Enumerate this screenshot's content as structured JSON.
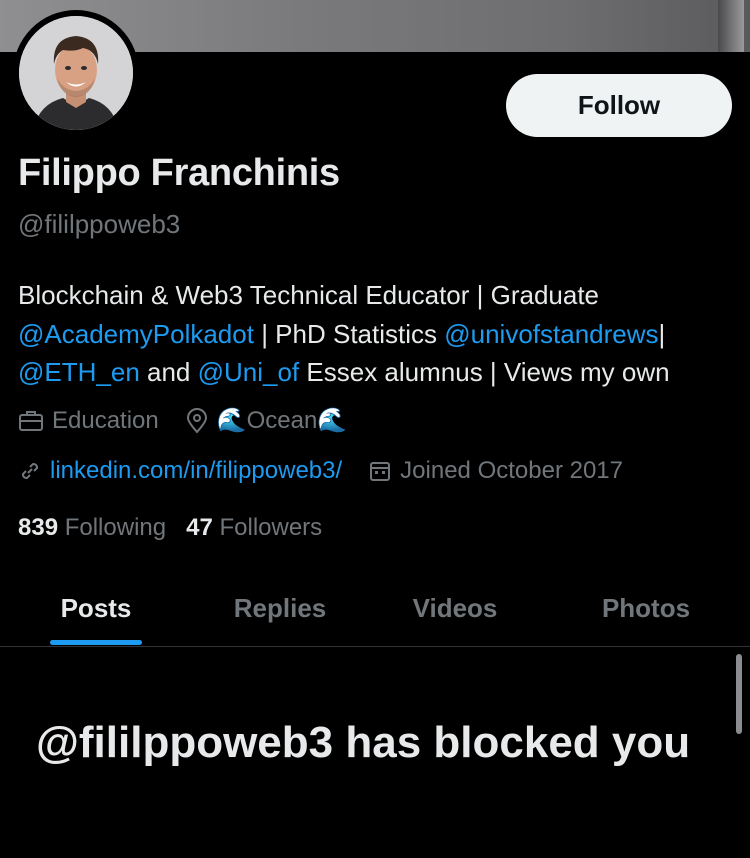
{
  "profile": {
    "name": "Filippo Franchinis",
    "handle": "@fililppoweb3",
    "follow_label": "Follow",
    "bio": {
      "line1": "Blockchain & Web3 Technical Educator | Graduate",
      "line2_link1": "@AcademyPolkadot",
      "line2_text": " | PhD Statistics ",
      "line2_link2": "@univofstandrews",
      "line2_end": "|",
      "line3_link1": "@ETH_en",
      "line3_text1": " and ",
      "line3_link2": "@Uni_of",
      "line3_text2": " Essex alumnus | Views my own"
    },
    "category": "Education",
    "location": "🌊Ocean🌊",
    "website": "linkedin.com/in/filippoweb3/",
    "joined": "Joined October 2017"
  },
  "stats": {
    "following_count": "839",
    "following_label": "Following",
    "followers_count": "47",
    "followers_label": "Followers"
  },
  "tabs": [
    {
      "label": "Posts",
      "active": true
    },
    {
      "label": "Replies",
      "active": false
    },
    {
      "label": "Videos",
      "active": false
    },
    {
      "label": "Photos",
      "active": false
    }
  ],
  "blocked_message": "@fililppoweb3 has blocked you",
  "icons": {
    "category": "briefcase-icon",
    "location": "location-pin-icon",
    "website": "link-icon",
    "joined": "calendar-icon"
  },
  "colors": {
    "background": "#000000",
    "text": "#e7e9ea",
    "muted": "#71767b",
    "accent": "#1d9bf0",
    "button_bg": "#eff3f4"
  }
}
